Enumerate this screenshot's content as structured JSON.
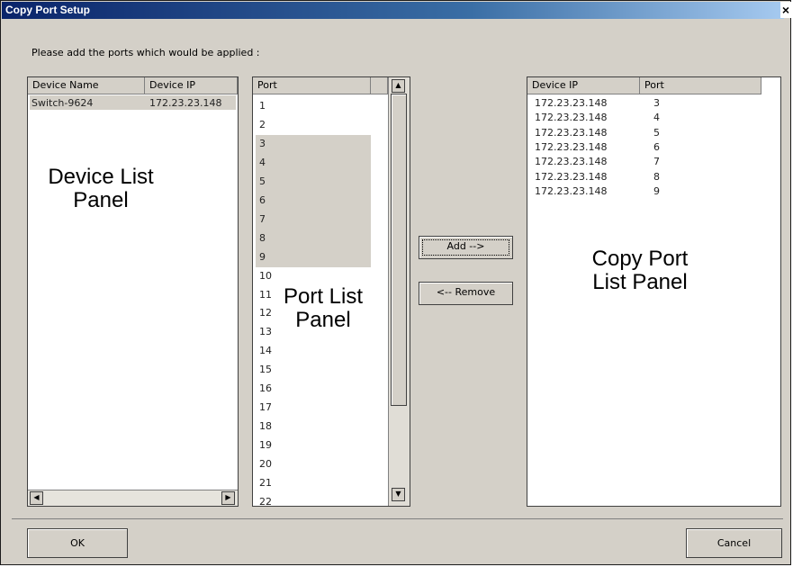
{
  "window": {
    "title": "Copy Port Setup",
    "close_glyph": "×"
  },
  "instruction": "Please add the ports which would be applied :",
  "device_panel": {
    "columns": [
      "Device Name",
      "Device IP"
    ],
    "rows": [
      {
        "name": "Switch-9624",
        "ip": "172.23.23.148"
      }
    ],
    "scroll_left_glyph": "◀",
    "scroll_right_glyph": "▶"
  },
  "port_panel": {
    "header": "Port",
    "ports": [
      "1",
      "2",
      "3",
      "4",
      "5",
      "6",
      "7",
      "8",
      "9",
      "10",
      "11",
      "12",
      "13",
      "14",
      "15",
      "16",
      "17",
      "18",
      "19",
      "20",
      "21",
      "22"
    ],
    "selected_ports": [
      "3",
      "4",
      "5",
      "6",
      "7",
      "8",
      "9"
    ],
    "scroll_up_glyph": "▲",
    "scroll_down_glyph": "▼"
  },
  "copy_panel": {
    "columns": [
      "Device IP",
      "Port"
    ],
    "rows": [
      {
        "ip": "172.23.23.148",
        "port": "3"
      },
      {
        "ip": "172.23.23.148",
        "port": "4"
      },
      {
        "ip": "172.23.23.148",
        "port": "5"
      },
      {
        "ip": "172.23.23.148",
        "port": "6"
      },
      {
        "ip": "172.23.23.148",
        "port": "7"
      },
      {
        "ip": "172.23.23.148",
        "port": "8"
      },
      {
        "ip": "172.23.23.148",
        "port": "9"
      }
    ]
  },
  "buttons": {
    "add": "Add -->",
    "remove": "<-- Remove",
    "ok": "OK",
    "cancel": "Cancel"
  },
  "annotations": {
    "device_list": [
      "Device List",
      "Panel"
    ],
    "port_list": [
      "Port List",
      "Panel"
    ],
    "copy_port_list": [
      "Copy Port",
      "List Panel"
    ]
  }
}
